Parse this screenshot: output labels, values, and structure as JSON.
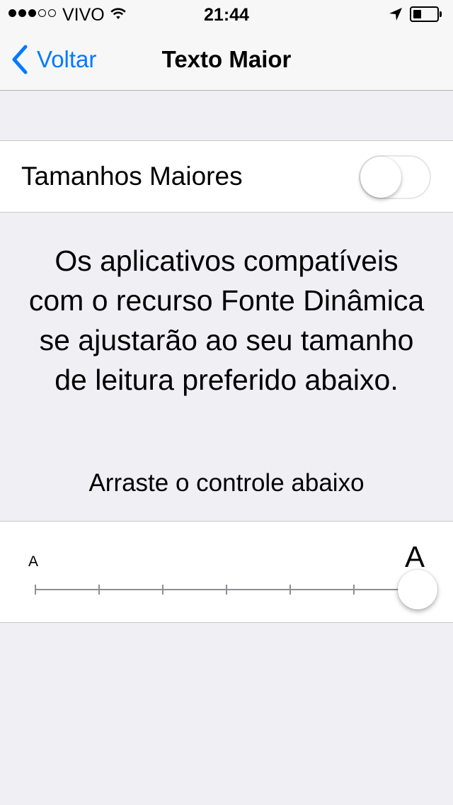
{
  "status_bar": {
    "signal_strength": "3 of 5",
    "carrier": "VIVO",
    "time": "21:44",
    "wifi_icon": "wifi-icon",
    "location_icon": "location-arrow-icon",
    "battery_level": 0.3
  },
  "nav": {
    "back_label": "Voltar",
    "back_icon": "chevron-left-icon",
    "title": "Texto Maior",
    "accent_color": "#007aff"
  },
  "toggle": {
    "label": "Tamanhos Maiores",
    "state": "off"
  },
  "description": "Os aplicativos compatíveis com o recurso Fonte Dinâmica se ajustarão ao seu tamanho de leitura preferido abaixo.",
  "instruction": "Arraste o controle abaixo",
  "slider": {
    "min_label": "A",
    "max_label": "A",
    "steps": 7,
    "selected_step": 7
  }
}
